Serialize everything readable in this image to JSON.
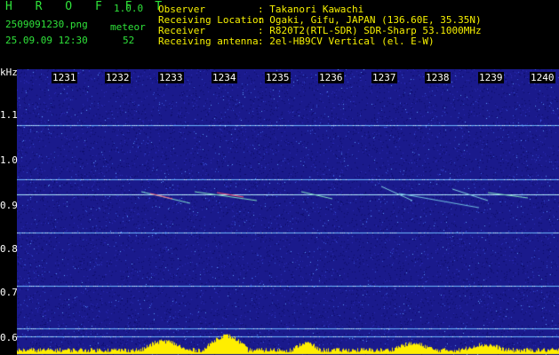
{
  "app": {
    "name": "H R O F F T",
    "version": "1.0.0"
  },
  "file": {
    "name": "2509091230.png",
    "datetime": "25.09.09 12:30"
  },
  "meteor": {
    "label": "meteor",
    "count": "52"
  },
  "info": {
    "rows": [
      {
        "label": "Observer",
        "value": ": Takanori Kawachi"
      },
      {
        "label": "Receiving Location",
        "value": ": Ogaki, Gifu, JAPAN (136.60E, 35.35N)"
      },
      {
        "label": "Receiver",
        "value": ": R820T2(RTL-SDR) SDR-Sharp 53.1000MHz"
      },
      {
        "label": "Receiving antenna",
        "value": ": 2el-HB9CV Vertical (el. E-W)"
      }
    ]
  },
  "axis": {
    "unit": "kHz",
    "y_ticks": [
      "1.1",
      "1.0",
      "0.9",
      "0.8",
      "0.7",
      "0.6"
    ],
    "x_ticks": [
      "1231",
      "1232",
      "1233",
      "1234",
      "1235",
      "1236",
      "1237",
      "1238",
      "1239",
      "1240"
    ]
  },
  "colors": {
    "background": "#000000",
    "plot_noise": "#1a1a8c",
    "header_green": "#2fe33a",
    "header_yellow": "#f6f000",
    "echo_line": "#7fd0ff",
    "signal_bar": "#ffee00"
  }
}
